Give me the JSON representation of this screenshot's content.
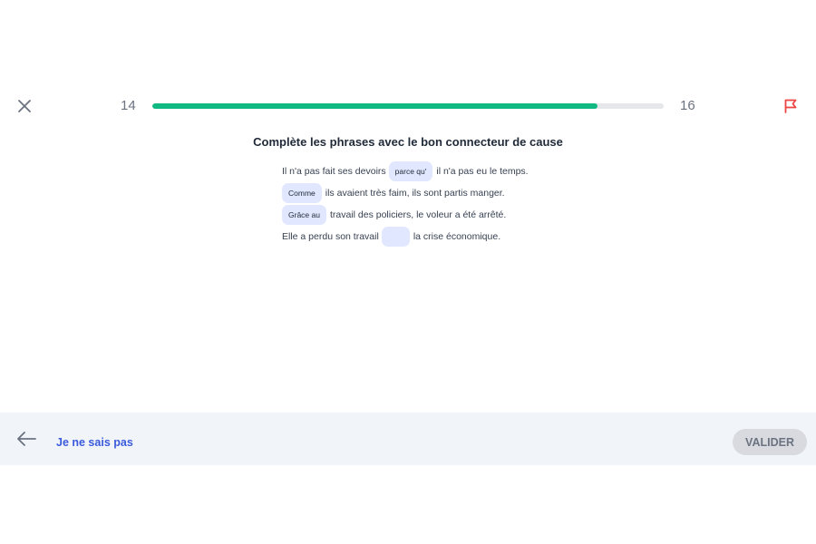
{
  "progress": {
    "current": "14",
    "total": "16",
    "fraction": 0.87
  },
  "icons": {
    "close": "close-icon",
    "flag": "flag-icon",
    "back": "arrow-left-icon"
  },
  "colors": {
    "progress": "#10b981",
    "flag": "#ef4444",
    "blank": "#e0e7ff",
    "link": "#3b5bdb"
  },
  "exercise": {
    "instruction": "Complète les phrases avec le bon connecteur de cause",
    "sentences": [
      {
        "before": "Il n'a pas fait ses devoirs",
        "answer": "parce qu'",
        "after": "il n'a pas eu le temps."
      },
      {
        "before": "",
        "answer": "Comme",
        "after": "ils avaient très faim, ils sont partis manger."
      },
      {
        "before": "",
        "answer": "Grâce au",
        "after": "travail des policiers, le voleur a été arrêté."
      },
      {
        "before": "Elle a perdu son travail",
        "answer": "",
        "after": "la crise économique."
      }
    ]
  },
  "footer": {
    "skip_label": "Je ne sais pas",
    "validate_label": "VALIDER"
  }
}
